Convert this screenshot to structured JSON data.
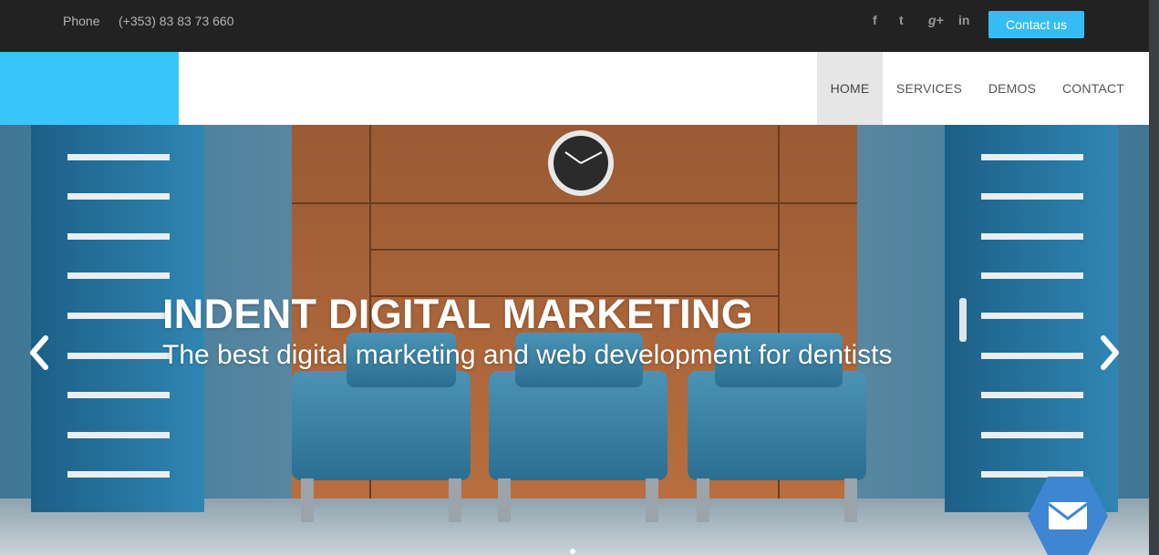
{
  "topbar": {
    "phone_label": "Phone",
    "phone_number": "(+353) 83 83 73 660",
    "social_icons": [
      "facebook-icon",
      "twitter-icon",
      "google-plus-icon",
      "linkedin-icon"
    ],
    "social_glyphs": {
      "facebook": "f",
      "twitter": "t",
      "google_plus": "g+",
      "linkedin": "in"
    },
    "contact_label": "Contact us"
  },
  "nav": {
    "items": [
      {
        "label": "HOME",
        "active": true
      },
      {
        "label": "SERVICES",
        "active": false
      },
      {
        "label": "DEMOS",
        "active": false
      },
      {
        "label": "CONTACT",
        "active": false
      }
    ]
  },
  "hero": {
    "title": "INDENT DIGITAL MARKETING",
    "subtitle": "The best digital marketing and web development for dentists",
    "prev_icon": "chevron-left-icon",
    "next_icon": "chevron-right-icon",
    "slide_count": 1,
    "active_slide": 1
  },
  "fab": {
    "icon": "envelope-icon"
  },
  "colors": {
    "accent": "#35bdf3",
    "logo_block": "#38c6fa",
    "topbar_bg": "#222222",
    "nav_active_bg": "#e6e6e6",
    "fab_bg": "#3e86d2"
  }
}
